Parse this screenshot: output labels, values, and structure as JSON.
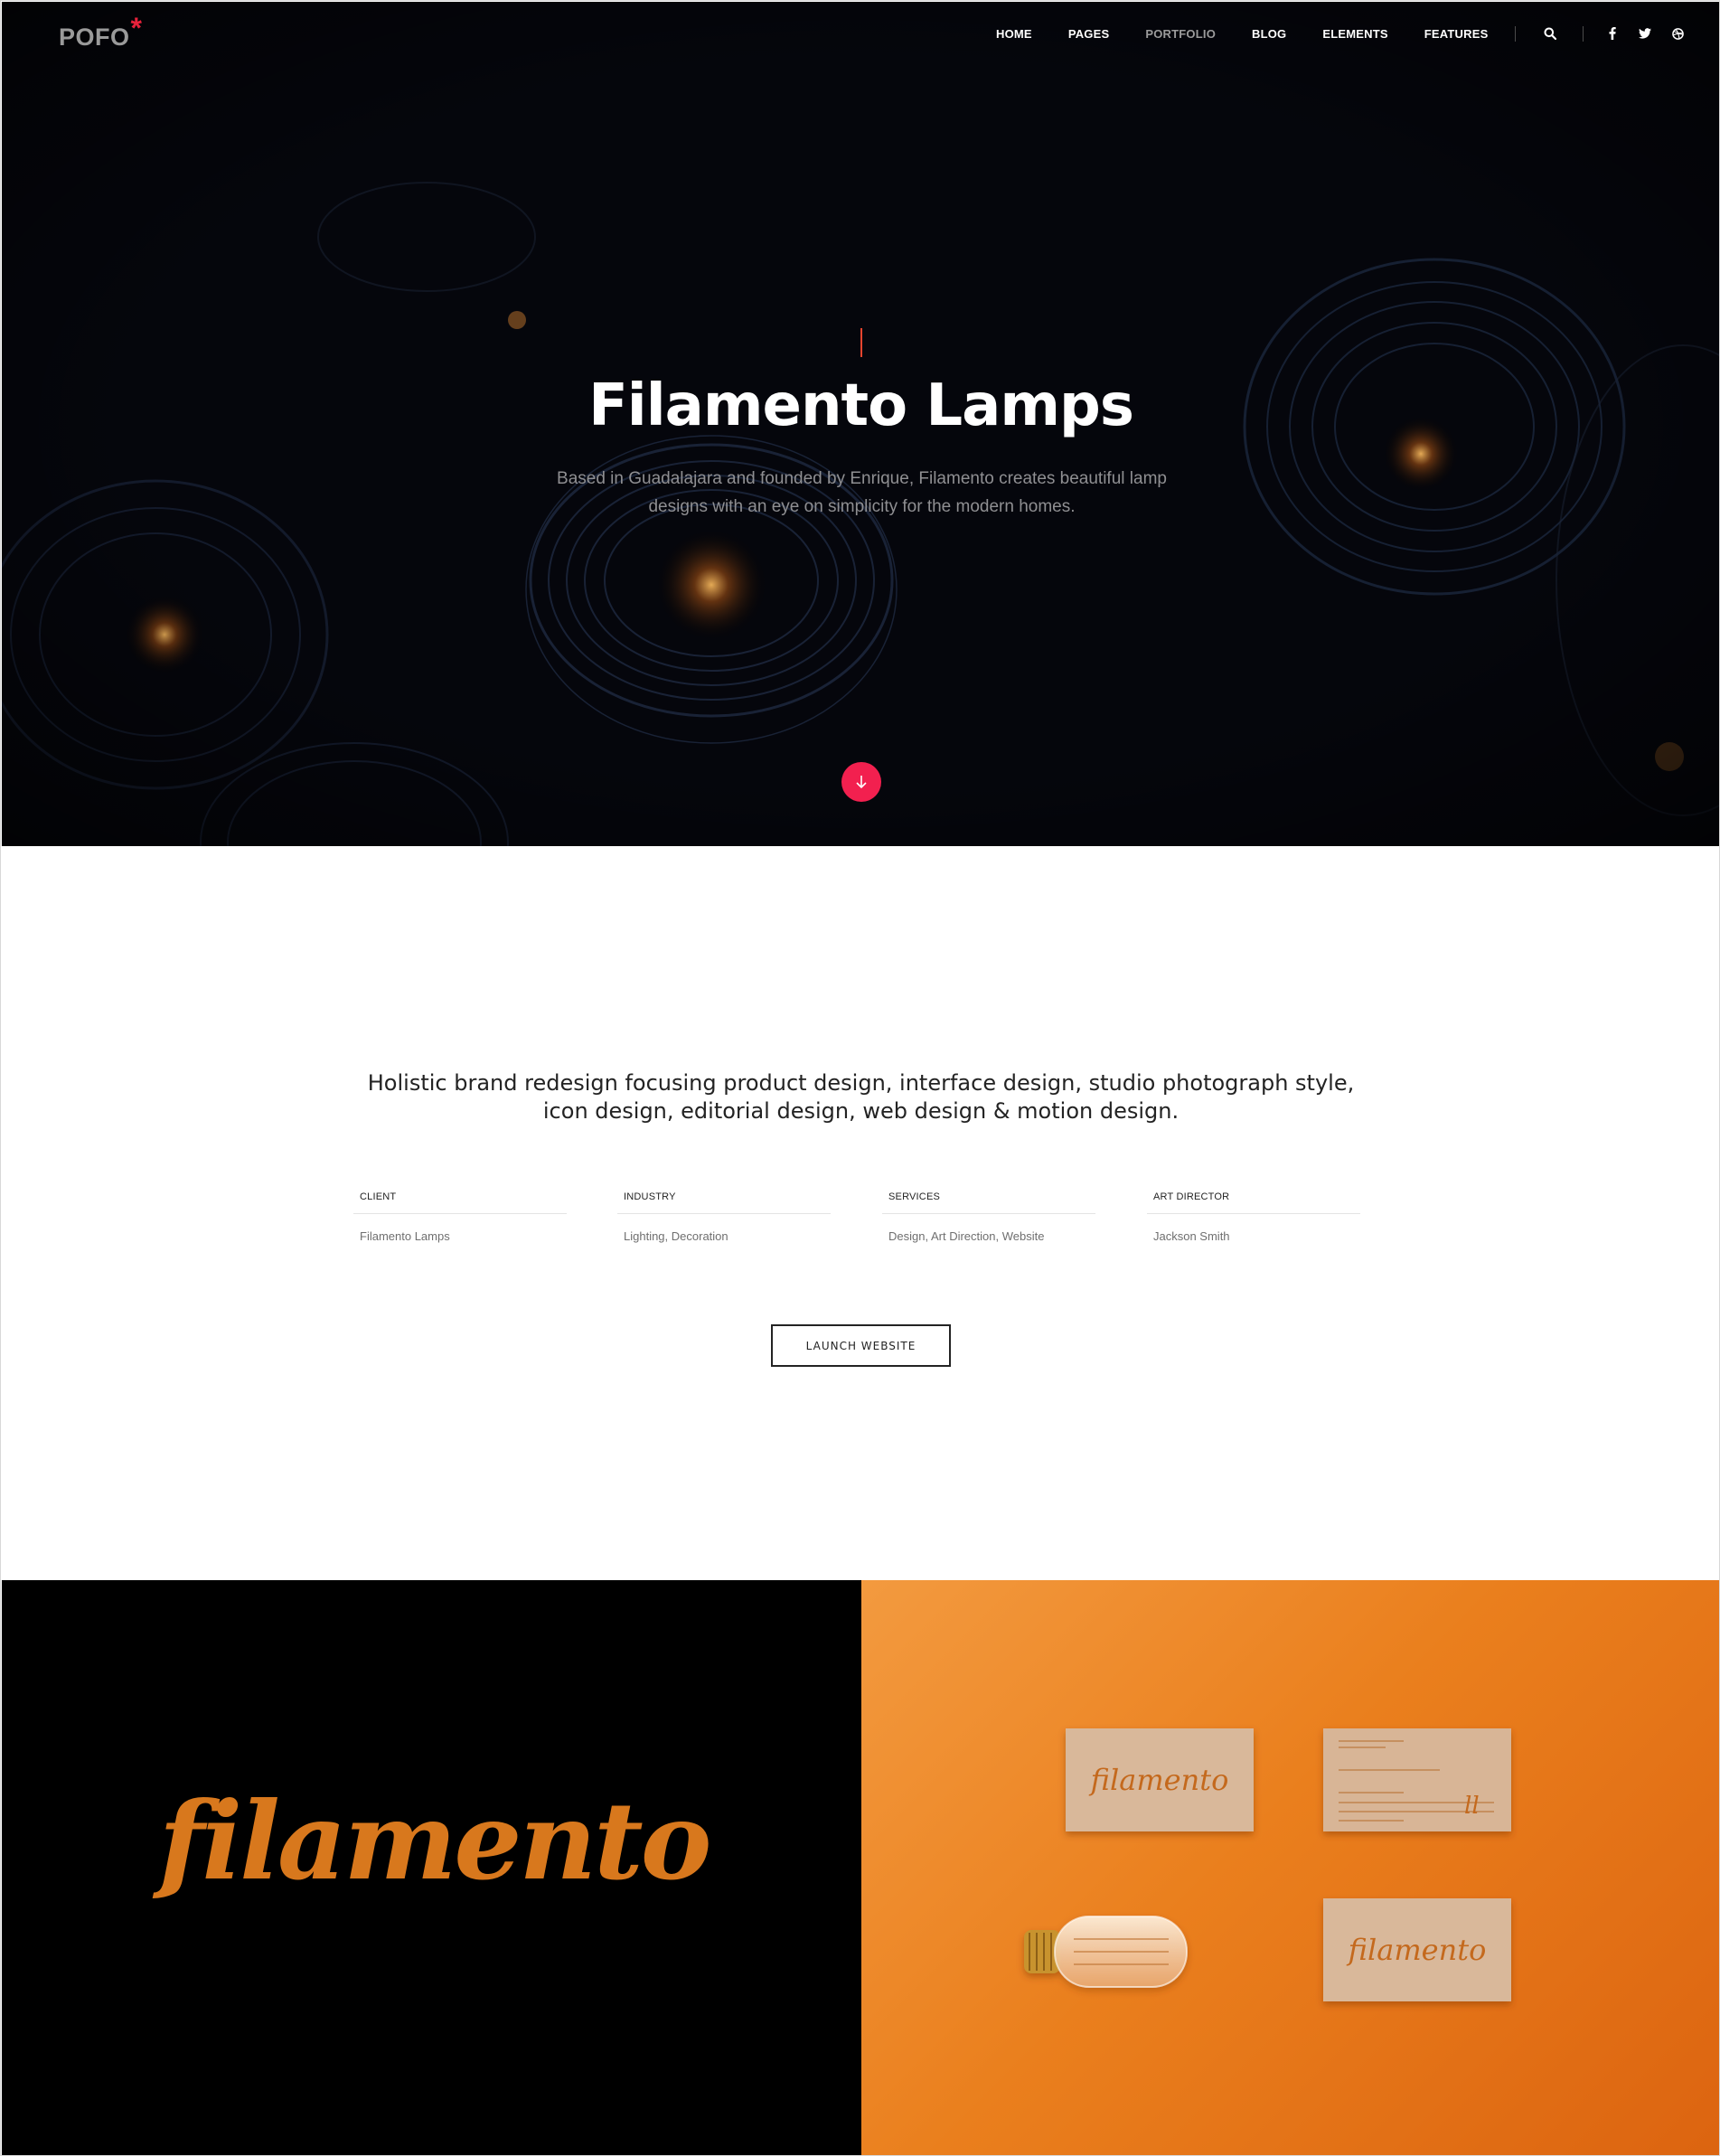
{
  "brand": {
    "logo_text": "POFO",
    "logo_mark": "*",
    "accent": "#e8213a"
  },
  "nav": {
    "items": [
      {
        "label": "HOME",
        "active": false
      },
      {
        "label": "PAGES",
        "active": false
      },
      {
        "label": "PORTFOLIO",
        "active": true
      },
      {
        "label": "BLOG",
        "active": false
      },
      {
        "label": "ELEMENTS",
        "active": false
      },
      {
        "label": "FEATURES",
        "active": false
      }
    ],
    "icons": [
      "search-icon",
      "facebook-icon",
      "twitter-icon",
      "dribbble-icon"
    ]
  },
  "hero": {
    "title": "Filamento Lamps",
    "description": "Based in Guadalajara and founded by Enrique, Filamento creates beautiful lamp designs with an eye on simplicity for the modern homes.",
    "scroll_icon": "arrow-down-icon",
    "scroll_color": "#f2204f"
  },
  "about": {
    "lead": "Holistic brand redesign focusing product design, interface design, studio photograph style, icon design, editorial design, web design & motion design.",
    "meta": [
      {
        "label": "CLIENT",
        "value": "Filamento Lamps"
      },
      {
        "label": "INDUSTRY",
        "value": "Lighting, Decoration"
      },
      {
        "label": "SERVICES",
        "value": "Design, Art Direction, Website"
      },
      {
        "label": "ART DIRECTOR",
        "value": "Jackson Smith"
      }
    ],
    "cta_label": "LAUNCH WEBSITE"
  },
  "gallery": {
    "wordmark": "filamento",
    "card_wordmark": "filamento"
  }
}
